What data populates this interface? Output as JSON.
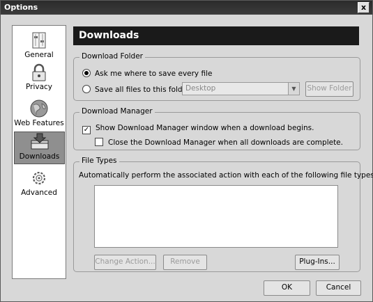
{
  "window": {
    "title": "Options",
    "close_label": "x"
  },
  "sidebar": {
    "items": [
      {
        "label": "General",
        "icon": "general-icon"
      },
      {
        "label": "Privacy",
        "icon": "lock-icon"
      },
      {
        "label": "Web Features",
        "icon": "globe-icon"
      },
      {
        "label": "Downloads",
        "icon": "downloads-icon",
        "selected": true
      },
      {
        "label": "Advanced",
        "icon": "gear-icon"
      }
    ]
  },
  "header": {
    "title": "Downloads"
  },
  "download_folder": {
    "group_label": "Download Folder",
    "ask_label": "Ask me where to save every file",
    "ask_selected": true,
    "save_label": "Save all files to this folder:",
    "folder_value": "Desktop",
    "show_folder_label": "Show Folder"
  },
  "download_manager": {
    "group_label": "Download Manager",
    "show_label": "Show Download Manager window when a download begins.",
    "show_checked": true,
    "close_label": "Close the Download Manager when all downloads are complete.",
    "close_checked": false
  },
  "file_types": {
    "group_label": "File Types",
    "description": "Automatically perform the associated action with each of the following file types:",
    "change_action_label": "Change Action...",
    "remove_label": "Remove",
    "plugins_label": "Plug-Ins..."
  },
  "footer": {
    "ok_label": "OK",
    "cancel_label": "Cancel"
  }
}
